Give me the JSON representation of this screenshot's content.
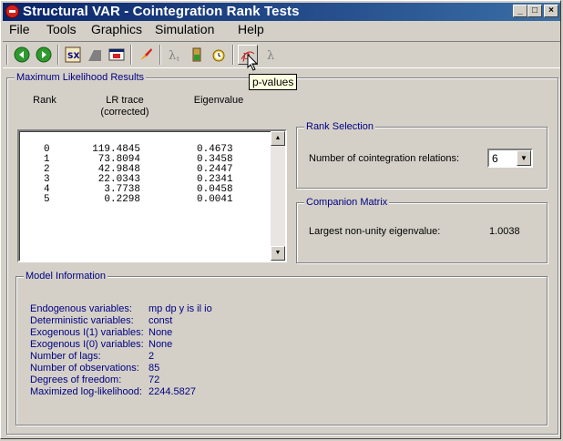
{
  "window": {
    "title": "Structural VAR - Cointegration Rank Tests",
    "controls": {
      "minimize": "_",
      "maximize": "□",
      "close": "×"
    }
  },
  "menu": [
    "File",
    "Tools",
    "Graphics",
    "Simulation",
    "Help"
  ],
  "toolbar": {
    "icons": [
      "back-icon",
      "forward-icon",
      "sx-icon",
      "chart-icon",
      "window-icon",
      "rocket-icon",
      "lambda-t-icon",
      "battery-icon",
      "alarm-icon",
      "p-values-icon",
      "lambda-icon"
    ],
    "tooltip": "p-values"
  },
  "ml_results": {
    "legend": "Maximum Likelihood Results",
    "col_rank": "Rank",
    "col_lr_line1": "LR trace",
    "col_lr_line2": "(corrected)",
    "col_eigen": "Eigenvalue",
    "rows": [
      {
        "rank": "0",
        "lr": "119.4845",
        "eig": "0.4673"
      },
      {
        "rank": "1",
        "lr": "73.8094",
        "eig": "0.3458"
      },
      {
        "rank": "2",
        "lr": "42.9848",
        "eig": "0.2447"
      },
      {
        "rank": "3",
        "lr": "22.0343",
        "eig": "0.2341"
      },
      {
        "rank": "4",
        "lr": "3.7738",
        "eig": "0.0458"
      },
      {
        "rank": "5",
        "lr": "0.2298",
        "eig": "0.0041"
      }
    ]
  },
  "rank_selection": {
    "legend": "Rank Selection",
    "label": "Number of cointegration relations:",
    "value": "6"
  },
  "companion": {
    "legend": "Companion Matrix",
    "label": "Largest non-unity eigenvalue:",
    "value": "1.0038"
  },
  "model_info": {
    "legend": "Model Information",
    "items": [
      {
        "label": "Endogenous variables:",
        "value": "mp dp y is il io"
      },
      {
        "label": "Deterministic variables:",
        "value": "const"
      },
      {
        "label": "Exogenous I(1) variables:",
        "value": "None"
      },
      {
        "label": "Exogenous I(0) variables:",
        "value": "None"
      },
      {
        "label": "Number of lags:",
        "value": "2"
      },
      {
        "label": "Number of observations:",
        "value": "85"
      },
      {
        "label": "Degrees of freedom:",
        "value": "72"
      },
      {
        "label": "Maximized log-likelihood:",
        "value": "2244.5827"
      }
    ]
  }
}
